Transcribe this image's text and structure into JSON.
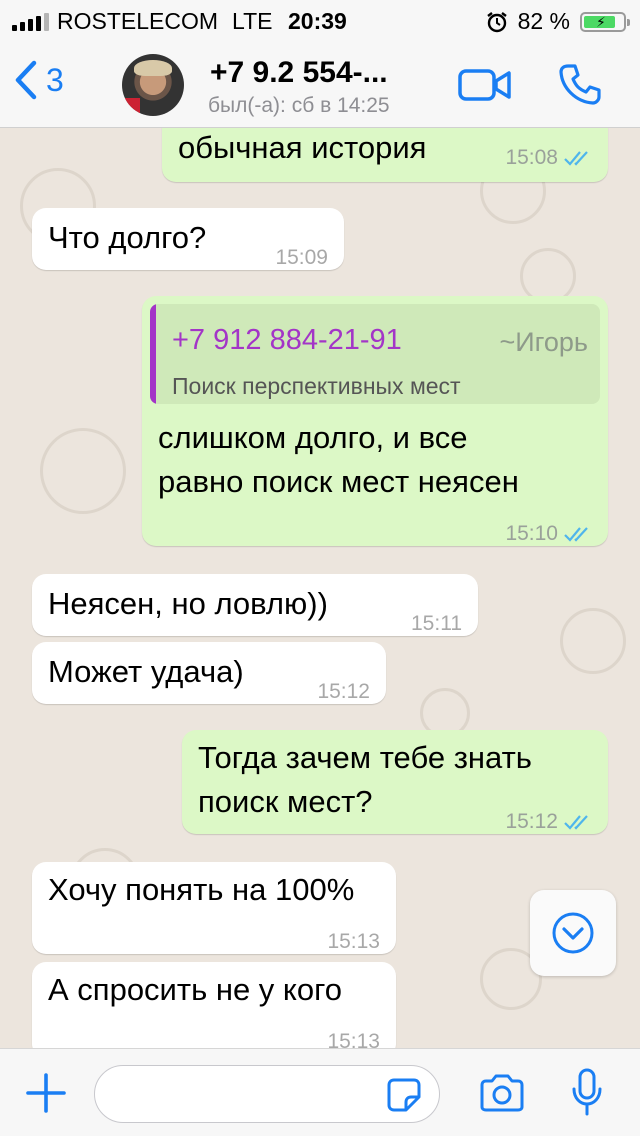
{
  "status_bar": {
    "carrier": "ROSTELECOM",
    "network": "LTE",
    "time": "20:39",
    "battery_text": "82 %",
    "battery_level": 0.82,
    "accent": "#4cd964"
  },
  "header": {
    "back_count": "3",
    "contact_name": "+7 9.2 554-...",
    "last_seen": "был(-а): сб в 14:25",
    "accent": "#1a7ef3"
  },
  "messages": [
    {
      "dir": "out",
      "text": "обычная история",
      "time": "15:08"
    },
    {
      "dir": "in",
      "text": "Что долго?",
      "time": "15:09"
    },
    {
      "dir": "out",
      "quote": {
        "phone": "+7 912 884-21-91",
        "name": "~Игорь",
        "text": "Поиск перспективных мест"
      },
      "line1": "слишком долго, и все",
      "line2": "равно поиск мест неясен",
      "time": "15:10"
    },
    {
      "dir": "in",
      "text": "Неясен, но ловлю))",
      "time": "15:11"
    },
    {
      "dir": "in",
      "text": "Может удача)",
      "time": "15:12"
    },
    {
      "dir": "out",
      "line1": "Тогда зачем тебе знать",
      "line2": "поиск мест?",
      "time": "15:12"
    },
    {
      "dir": "in",
      "text": "Хочу понять на 100%",
      "time": "15:13"
    },
    {
      "dir": "in",
      "text": "А спросить не у кого",
      "time": "15:13"
    }
  ],
  "input": {
    "value": "",
    "placeholder": ""
  },
  "colors": {
    "outgoing_bubble": "#dcf8c6",
    "incoming_bubble": "#ffffff",
    "quote_accent": "#a335c7",
    "read_ticks": "#4fb5ec"
  }
}
